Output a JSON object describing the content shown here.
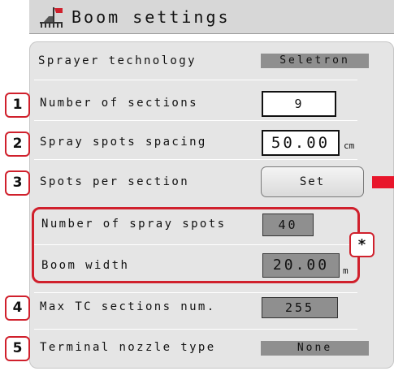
{
  "header": {
    "title": "Boom settings",
    "logo_icon": "sprayer-boom-icon"
  },
  "rows": {
    "sprayer_technology": {
      "label": "Sprayer technology",
      "value": "Seletron"
    },
    "number_of_sections": {
      "label": "Number of sections",
      "value": "9",
      "callout": "1"
    },
    "spray_spots_spacing": {
      "label": "Spray spots spacing",
      "value": "50.00",
      "unit": "cm",
      "callout": "2"
    },
    "spots_per_section": {
      "label": "Spots per section",
      "button": "Set",
      "callout": "3"
    },
    "number_of_spray_spots": {
      "label": "Number of spray spots",
      "value": "40"
    },
    "boom_width": {
      "label": "Boom width",
      "value": "20.00",
      "unit": "m"
    },
    "group_callout": "*",
    "max_tc_sections": {
      "label": "Max TC sections num.",
      "value": "255",
      "callout": "4"
    },
    "terminal_nozzle_type": {
      "label": "Terminal nozzle type",
      "value": "None",
      "callout": "5"
    }
  },
  "colors": {
    "accent": "#d0202c",
    "marker": "#e8162b",
    "panel": "#e5e5e5",
    "readonly_box": "#8f8f8f"
  }
}
